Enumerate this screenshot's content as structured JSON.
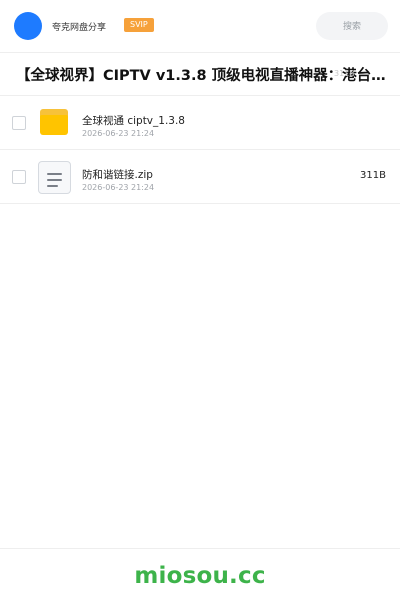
{
  "header": {
    "brand": "夸克网盘分享",
    "badge": "SVIP",
    "search_placeholder": "搜索",
    "accent_color": "#1e7bff",
    "badge_color": "#f6a13a"
  },
  "share": {
    "title": "【全球视界】CIPTV v1.3.8 顶级电视直播神器：港台、…",
    "size_hint": "311B"
  },
  "files": [
    {
      "type": "folder",
      "icon": "folder-icon",
      "name": "全球视通 ciptv_1.3.8",
      "date": "2026-06-23 21:24",
      "size": ""
    },
    {
      "type": "file",
      "icon": "document-icon",
      "name": "防和谐链接.zip",
      "date": "2026-06-23 21:24",
      "size": "311B"
    }
  ],
  "footer": {
    "watermark": "miosou.cc",
    "watermark_color": "#3db34a"
  }
}
